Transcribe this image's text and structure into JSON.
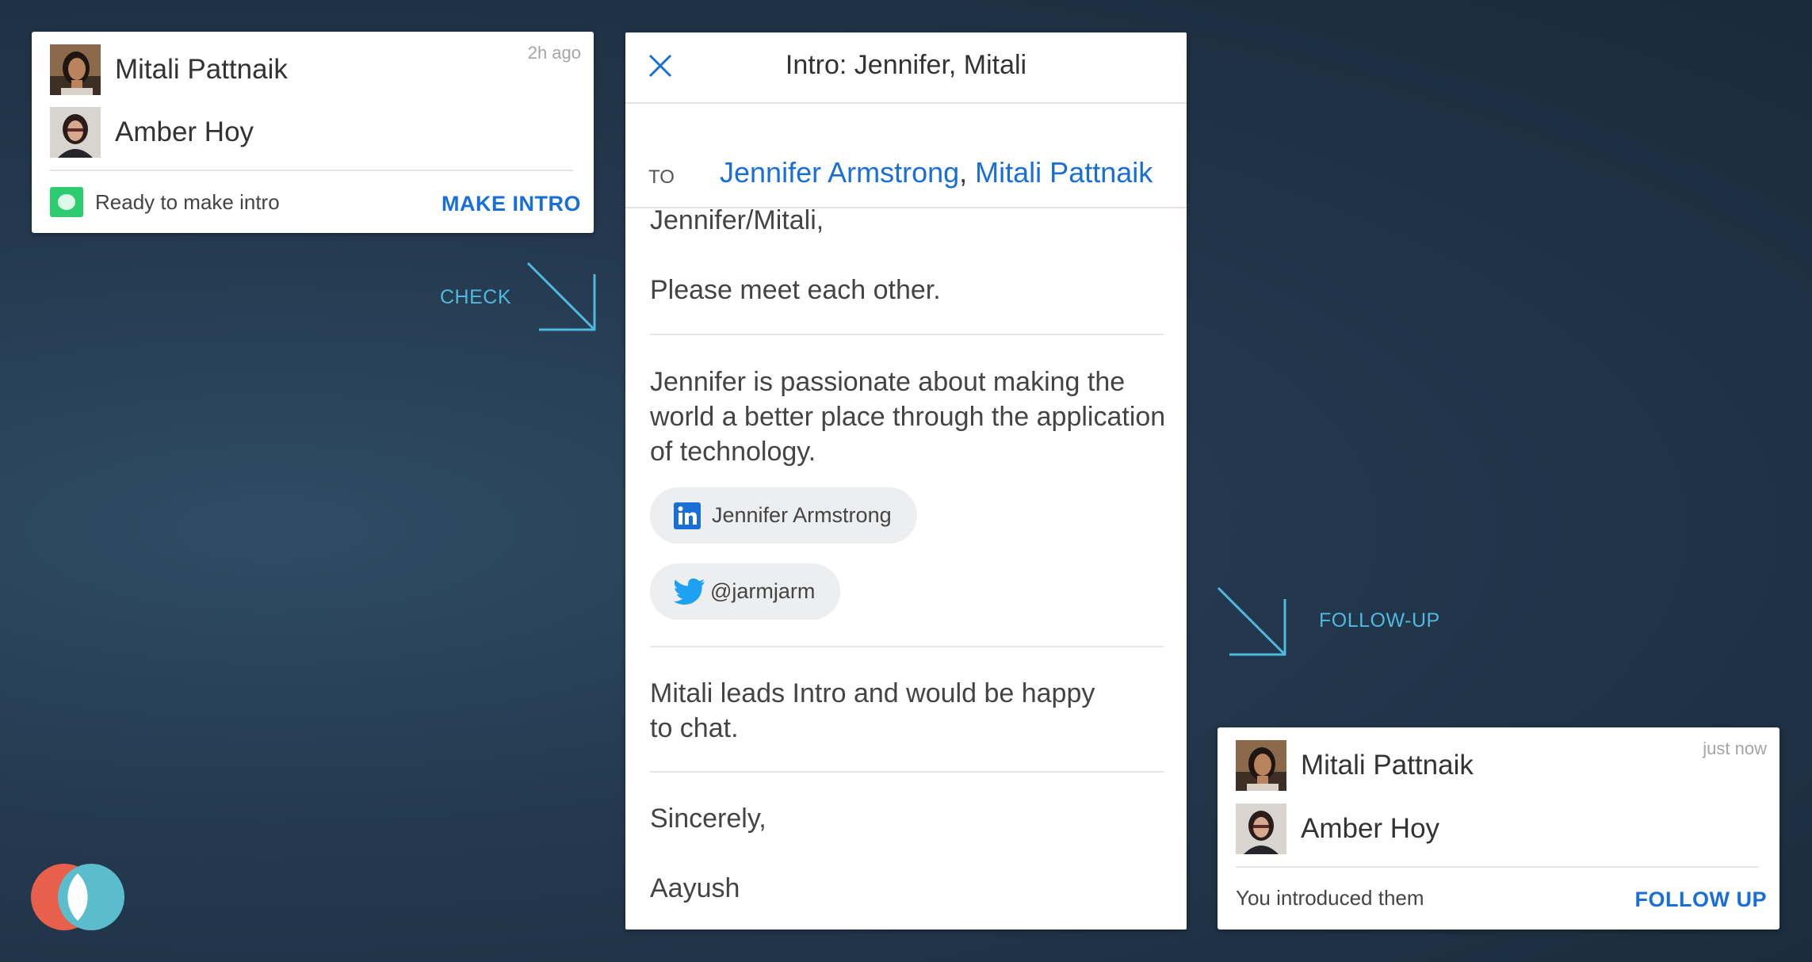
{
  "colors": {
    "accent_blue": "#1a6fd6",
    "annotation_cyan": "#4fb9de",
    "ready_green": "#2ecc71",
    "logo_red": "#e8604c",
    "logo_teal": "#5bbccd"
  },
  "pending_card": {
    "timestamp": "2h ago",
    "person1": "Mitali Pattnaik",
    "person2": "Amber Hoy",
    "status": "Ready to make intro",
    "action": "MAKE INTRO"
  },
  "intro_email": {
    "title": "Intro: Jennifer, Mitali",
    "to_label": "TO",
    "recipients": [
      "Jennifer Armstrong",
      "Mitali Pattnaik"
    ],
    "recipient_separator": ",",
    "greeting": "Jennifer/Mitali,",
    "opening": "Please meet each other.",
    "jennifer_blurb": [
      "Jennifer is passionate about making the",
      "world a better place through the application",
      "of technology."
    ],
    "linkedin_chip": "Jennifer Armstrong",
    "twitter_chip": "@jarmjarm",
    "mitali_blurb": [
      "Mitali leads Intro and would be happy",
      "to chat."
    ],
    "closing": "Sincerely,",
    "signature": "Aayush"
  },
  "annotations": {
    "check": "CHECK",
    "follow_up": "FOLLOW-UP"
  },
  "done_card": {
    "timestamp": "just now",
    "person1": "Mitali Pattnaik",
    "person2": "Amber Hoy",
    "status": "You introduced them",
    "action": "FOLLOW UP"
  },
  "icons": {
    "close": "close-icon",
    "linkedin": "linkedin-icon",
    "twitter": "twitter-icon",
    "logo": "intro-logo"
  }
}
